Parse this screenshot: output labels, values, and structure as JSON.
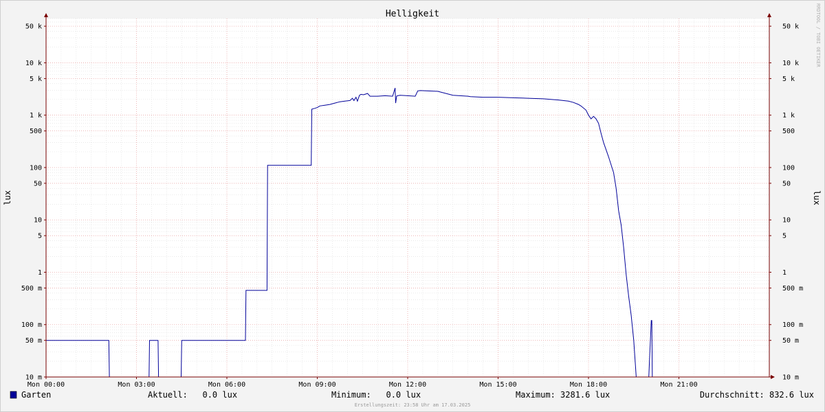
{
  "chart_data": {
    "type": "line",
    "title": "Helligkeit",
    "ylabel": "lux",
    "ylabel_right": "lux",
    "y_scale": "log",
    "ylim": [
      0.01,
      70000
    ],
    "y_ticks": [
      {
        "v": 0.01,
        "label": "10 m"
      },
      {
        "v": 0.05,
        "label": "50 m"
      },
      {
        "v": 0.1,
        "label": "100 m"
      },
      {
        "v": 0.5,
        "label": "500 m"
      },
      {
        "v": 1,
        "label": "1"
      },
      {
        "v": 5,
        "label": "5"
      },
      {
        "v": 10,
        "label": "10"
      },
      {
        "v": 50,
        "label": "50"
      },
      {
        "v": 100,
        "label": "100"
      },
      {
        "v": 500,
        "label": "500"
      },
      {
        "v": 1000,
        "label": "1 k"
      },
      {
        "v": 5000,
        "label": "5 k"
      },
      {
        "v": 10000,
        "label": "10 k"
      },
      {
        "v": 50000,
        "label": "50 k"
      }
    ],
    "xlim": [
      "00:00",
      "24:00"
    ],
    "x_ticks": [
      {
        "t": "00:00",
        "label": "Mon 00:00"
      },
      {
        "t": "03:00",
        "label": "Mon 03:00"
      },
      {
        "t": "06:00",
        "label": "Mon 06:00"
      },
      {
        "t": "09:00",
        "label": "Mon 09:00"
      },
      {
        "t": "12:00",
        "label": "Mon 12:00"
      },
      {
        "t": "15:00",
        "label": "Mon 15:00"
      },
      {
        "t": "18:00",
        "label": "Mon 18:00"
      },
      {
        "t": "21:00",
        "label": "Mon 21:00"
      }
    ],
    "grid": true,
    "colors": {
      "line": "#000099",
      "major_grid": "#e9a4a4",
      "minor_grid": "#dcdcdc",
      "axis": "#7a0000"
    },
    "series": [
      {
        "name": "Garten",
        "x": [
          "00:00",
          "02:05",
          "02:06",
          "03:25",
          "03:26",
          "03:43",
          "03:44",
          "04:29",
          "04:30",
          "06:37",
          "06:38",
          "07:20",
          "07:21",
          "08:48",
          "08:49",
          "08:55",
          "09:00",
          "09:05",
          "09:15",
          "09:25",
          "09:35",
          "09:45",
          "09:55",
          "10:05",
          "10:10",
          "10:13",
          "10:17",
          "10:20",
          "10:24",
          "10:27",
          "10:32",
          "10:40",
          "10:45",
          "11:00",
          "11:15",
          "11:30",
          "11:35",
          "11:36",
          "11:38",
          "11:40",
          "11:45",
          "12:00",
          "12:15",
          "12:20",
          "12:25",
          "12:40",
          "13:00",
          "13:30",
          "14:00",
          "14:05",
          "14:30",
          "15:00",
          "15:30",
          "16:00",
          "16:30",
          "17:00",
          "17:20",
          "17:30",
          "17:40",
          "17:45",
          "17:55",
          "18:00",
          "18:05",
          "18:10",
          "18:15",
          "18:20",
          "18:25",
          "18:30",
          "18:40",
          "18:50",
          "18:55",
          "19:00",
          "19:05",
          "19:10",
          "19:15",
          "19:20",
          "19:25",
          "19:30",
          "19:35",
          "19:40",
          "19:45",
          "19:50",
          "19:55",
          "20:00",
          "20:05",
          "20:06",
          "20:07",
          "20:20",
          "20:21",
          "20:55",
          "20:56",
          "21:00",
          "21:01",
          "24:00"
        ],
        "y": [
          0.05,
          0.05,
          0.01,
          0.01,
          0.05,
          0.05,
          0.01,
          0.01,
          0.05,
          0.05,
          0.45,
          0.45,
          110,
          110,
          1300,
          1350,
          1400,
          1500,
          1550,
          1600,
          1700,
          1800,
          1850,
          1900,
          2100,
          1900,
          2200,
          1850,
          2400,
          2500,
          2450,
          2600,
          2300,
          2300,
          2350,
          2300,
          3300,
          1700,
          2300,
          2350,
          2400,
          2350,
          2300,
          2900,
          2950,
          2900,
          2850,
          2400,
          2300,
          2250,
          2200,
          2200,
          2150,
          2100,
          2050,
          1950,
          1850,
          1750,
          1600,
          1500,
          1250,
          1000,
          850,
          950,
          850,
          700,
          450,
          300,
          160,
          80,
          40,
          15,
          8,
          3,
          0.9,
          0.35,
          0.15,
          0.05,
          0.01,
          0.01,
          0.01,
          0.01,
          0.01,
          0.01,
          0.12,
          0.12,
          0.01,
          0.01,
          0.01,
          0.01,
          0.01,
          0.01,
          0.01,
          0.01
        ]
      }
    ]
  },
  "legend": {
    "series_name": "Garten",
    "swatch_color": "#000099",
    "current": "Aktuell:   0.0 lux",
    "minimum": "Minimum:   0.0 lux",
    "maximum": "Maximum: 3281.6 lux",
    "average": "Durchschnitt: 832.6 lux"
  },
  "footer": "Erstellungszeit: 23:58 Uhr am 17.03.2025",
  "watermark": "RRDTOOL / TOBI OETIKER"
}
